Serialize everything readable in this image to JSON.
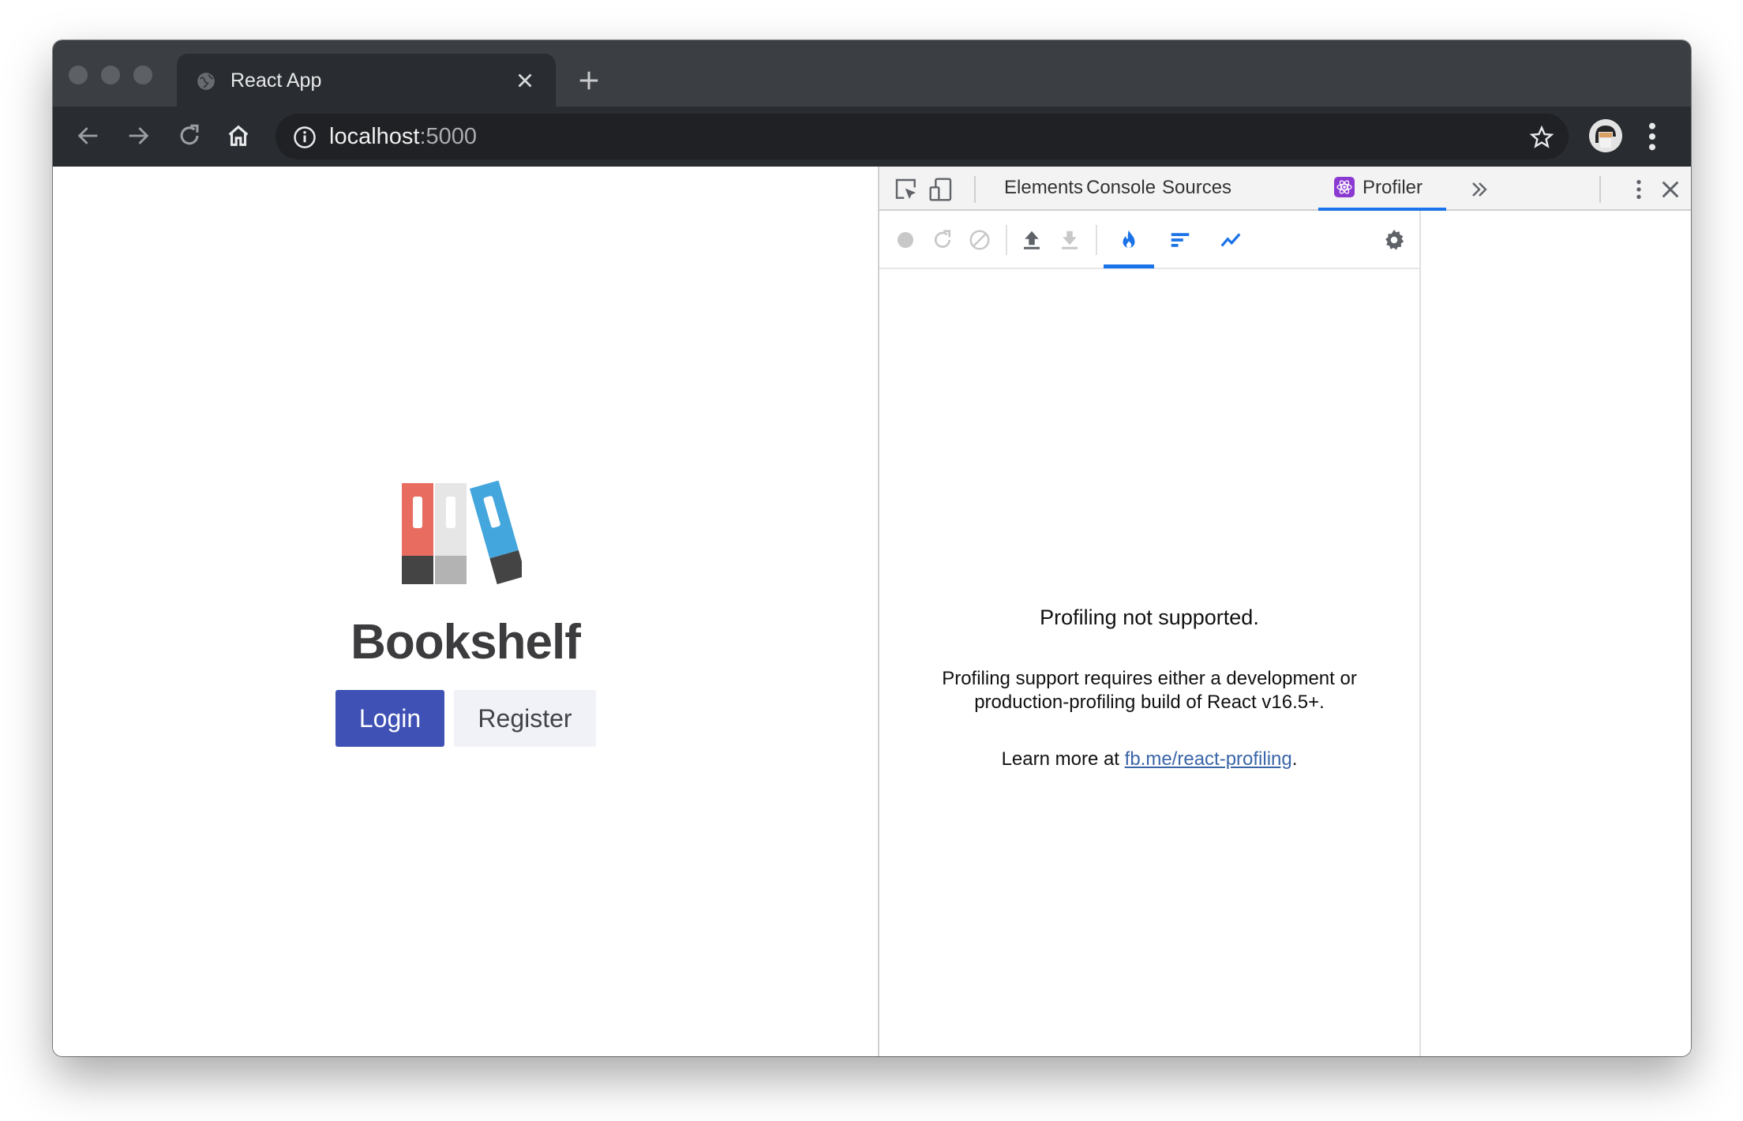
{
  "browser": {
    "tab": {
      "title": "React App",
      "favicon": "globe-icon"
    },
    "url": {
      "host": "localhost",
      "port": ":5000"
    }
  },
  "page": {
    "brand": "Bookshelf",
    "login_label": "Login",
    "register_label": "Register",
    "colors": {
      "primary": "#3f51b5",
      "secondary": "#f1f2f7"
    }
  },
  "devtools": {
    "tabs": [
      "Elements",
      "Console",
      "Sources",
      "Profiler"
    ],
    "active_tab": "Profiler",
    "accent": "#1a73e8",
    "profiler": {
      "title": "Profiling not supported.",
      "line1": "Profiling support requires either a development or",
      "line2": "production-profiling build of React v16.5+.",
      "learn_prefix": "Learn more at ",
      "learn_link": "fb.me/react-profiling",
      "learn_suffix": "."
    }
  }
}
